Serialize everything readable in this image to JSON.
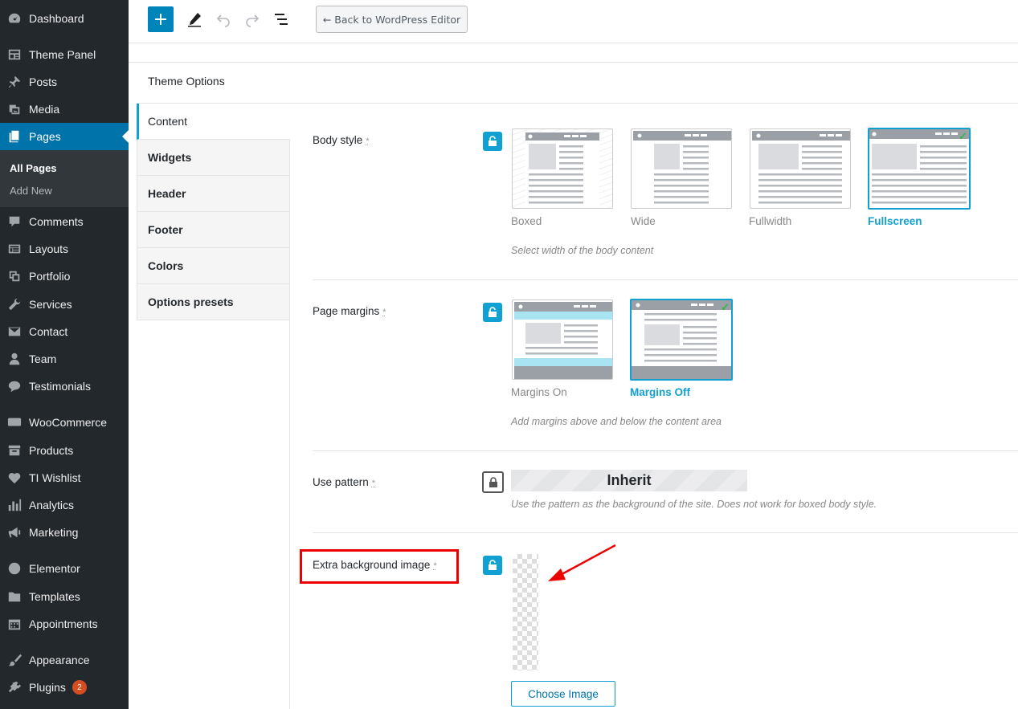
{
  "sidebar": {
    "items": [
      {
        "label": "Dashboard",
        "icon": "dashboard-icon"
      },
      {
        "label": "Theme Panel",
        "icon": "theme-panel-icon"
      },
      {
        "label": "Posts",
        "icon": "pin-icon"
      },
      {
        "label": "Media",
        "icon": "media-icon"
      },
      {
        "label": "Pages",
        "icon": "pages-icon"
      },
      {
        "label": "Comments",
        "icon": "comment-icon"
      },
      {
        "label": "Layouts",
        "icon": "layouts-icon"
      },
      {
        "label": "Portfolio",
        "icon": "portfolio-icon"
      },
      {
        "label": "Services",
        "icon": "wrench-icon"
      },
      {
        "label": "Contact",
        "icon": "envelope-icon"
      },
      {
        "label": "Team",
        "icon": "person-icon"
      },
      {
        "label": "Testimonials",
        "icon": "speech-bubble-icon"
      },
      {
        "label": "WooCommerce",
        "icon": "woo-icon"
      },
      {
        "label": "Products",
        "icon": "archive-icon"
      },
      {
        "label": "TI Wishlist",
        "icon": "heart-icon"
      },
      {
        "label": "Analytics",
        "icon": "bar-chart-icon"
      },
      {
        "label": "Marketing",
        "icon": "megaphone-icon"
      },
      {
        "label": "Elementor",
        "icon": "elementor-icon"
      },
      {
        "label": "Templates",
        "icon": "folder-icon"
      },
      {
        "label": "Appointments",
        "icon": "calendar-icon"
      },
      {
        "label": "Appearance",
        "icon": "brush-icon"
      },
      {
        "label": "Plugins",
        "icon": "plug-icon",
        "badge": "2"
      }
    ],
    "submenu": [
      "All Pages",
      "Add New"
    ]
  },
  "toolbar": {
    "back_label": "← Back to WordPress Editor"
  },
  "theme_options": {
    "title": "Theme Options",
    "tabs": [
      "Content",
      "Widgets",
      "Header",
      "Footer",
      "Colors",
      "Options presets"
    ]
  },
  "options": {
    "body_style": {
      "label": "Body style",
      "required_mark": "*",
      "choices": [
        "Boxed",
        "Wide",
        "Fullwidth",
        "Fullscreen"
      ],
      "selected": "Fullscreen",
      "description": "Select width of the body content"
    },
    "page_margins": {
      "label": "Page margins",
      "required_mark": "*",
      "choices": [
        "Margins On",
        "Margins Off"
      ],
      "selected": "Margins Off",
      "description": "Add margins above and below the content area"
    },
    "use_pattern": {
      "label": "Use pattern",
      "required_mark": "*",
      "value": "Inherit",
      "description": "Use the pattern as the background of the site. Does not work for boxed body style."
    },
    "extra_bg": {
      "label": "Extra background image",
      "required_mark": "*",
      "button": "Choose Image"
    }
  },
  "colors": {
    "sidebar_bg": "#23282d",
    "accent": "#0073aa",
    "lock_blue": "#11a0d2",
    "check_green": "#2fb844",
    "annotation_red": "#e00000"
  }
}
